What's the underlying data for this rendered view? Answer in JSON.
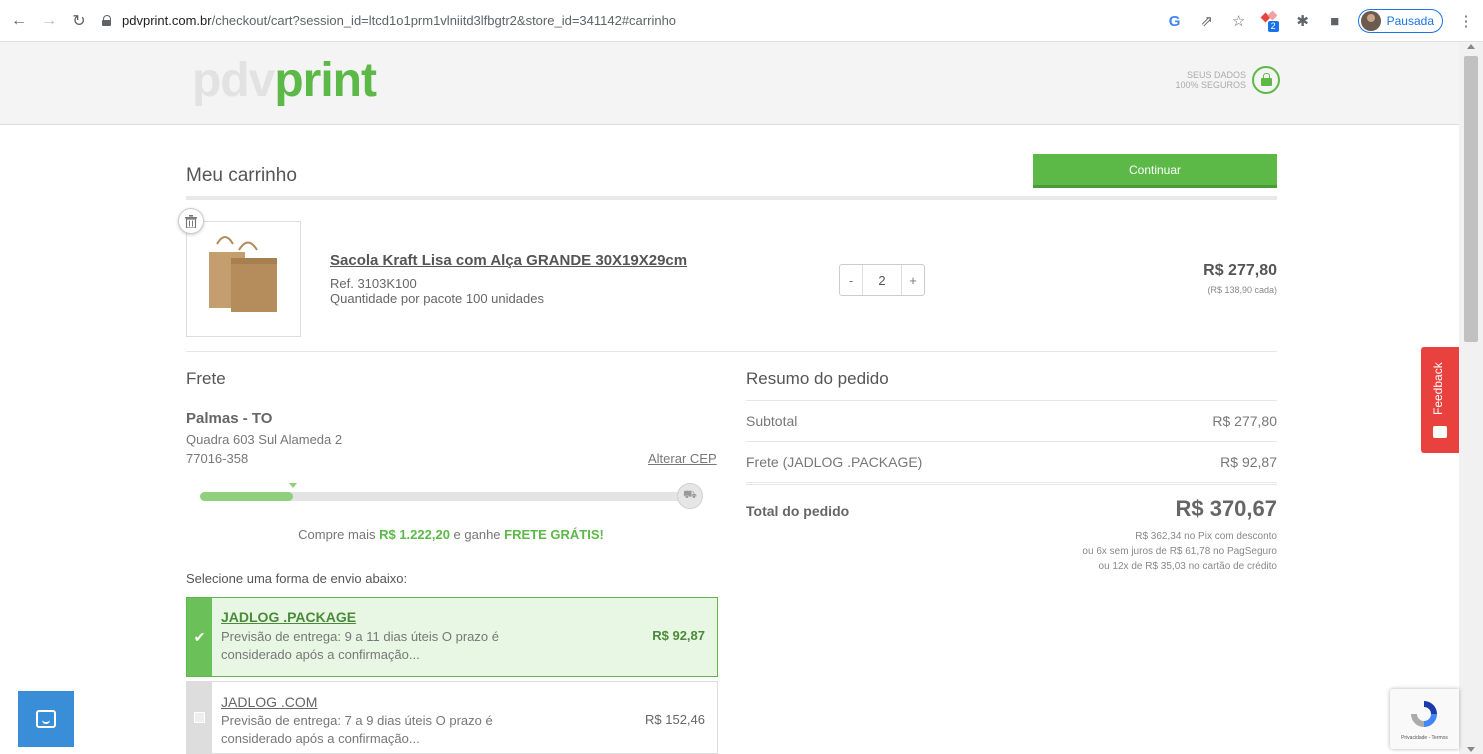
{
  "browser": {
    "url_host": "pdvprint.com.br",
    "url_rest": "/checkout/cart?session_id=ltcd1o1prm1vlniitd3lfbgtr2&store_id=341142#carrinho",
    "extension_badge": "2",
    "profile_label": "Pausada"
  },
  "header": {
    "logo_part1": "pdv",
    "logo_part2": "print",
    "secure_line1": "SEUS DADOS",
    "secure_line2": "100% SEGUROS"
  },
  "cart": {
    "title": "Meu carrinho",
    "continue_label": "Continuar",
    "item": {
      "name": "Sacola Kraft Lisa com Alça GRANDE 30X19X29cm",
      "ref": "Ref. 3103K100",
      "pack_info": "Quantidade por pacote 100 unidades",
      "qty": "2",
      "minus": "-",
      "plus": "+",
      "price": "R$ 277,80",
      "unit_price": "(R$ 138,90 cada)"
    }
  },
  "frete": {
    "title": "Frete",
    "city": "Palmas - TO",
    "address": "Quadra 603 Sul Alameda 2",
    "cep": "77016-358",
    "change_cep": "Alterar CEP",
    "progress": 0.19,
    "promo_prefix": "Compre mais ",
    "promo_amount": "R$ 1.222,20",
    "promo_middle": " e ganhe ",
    "promo_free": "FRETE GRÁTIS!",
    "select_label": "Selecione uma forma de envio abaixo:",
    "options": [
      {
        "name": "JADLOG .PACKAGE",
        "desc": "Previsão de entrega: 9 a 11 dias úteis O prazo é considerado após a confirmação...",
        "price": "R$ 92,87",
        "selected": true
      },
      {
        "name": "JADLOG .COM",
        "desc": "Previsão de entrega: 7 a 9 dias úteis O prazo é considerado após a confirmação...",
        "price": "R$ 152,46",
        "selected": false
      }
    ]
  },
  "summary": {
    "title": "Resumo do pedido",
    "subtotal_label": "Subtotal",
    "subtotal_value": "R$ 277,80",
    "shipping_label": "Frete (JADLOG .PACKAGE)",
    "shipping_value": "R$ 92,87",
    "total_label": "Total do pedido",
    "total_value": "R$ 370,67",
    "note1": "R$ 362,34 no Pix com desconto",
    "note2": "ou 6x sem juros de R$ 61,78 no PagSeguro",
    "note3": "ou 12x de R$ 35,03 no cartão de crédito"
  },
  "feedback_label": "Feedback",
  "recaptcha_text": "Privacidade - Termos",
  "colors": {
    "brand_green": "#5cb947",
    "feedback_red": "#e8413e",
    "chat_blue": "#3a8ed8"
  }
}
